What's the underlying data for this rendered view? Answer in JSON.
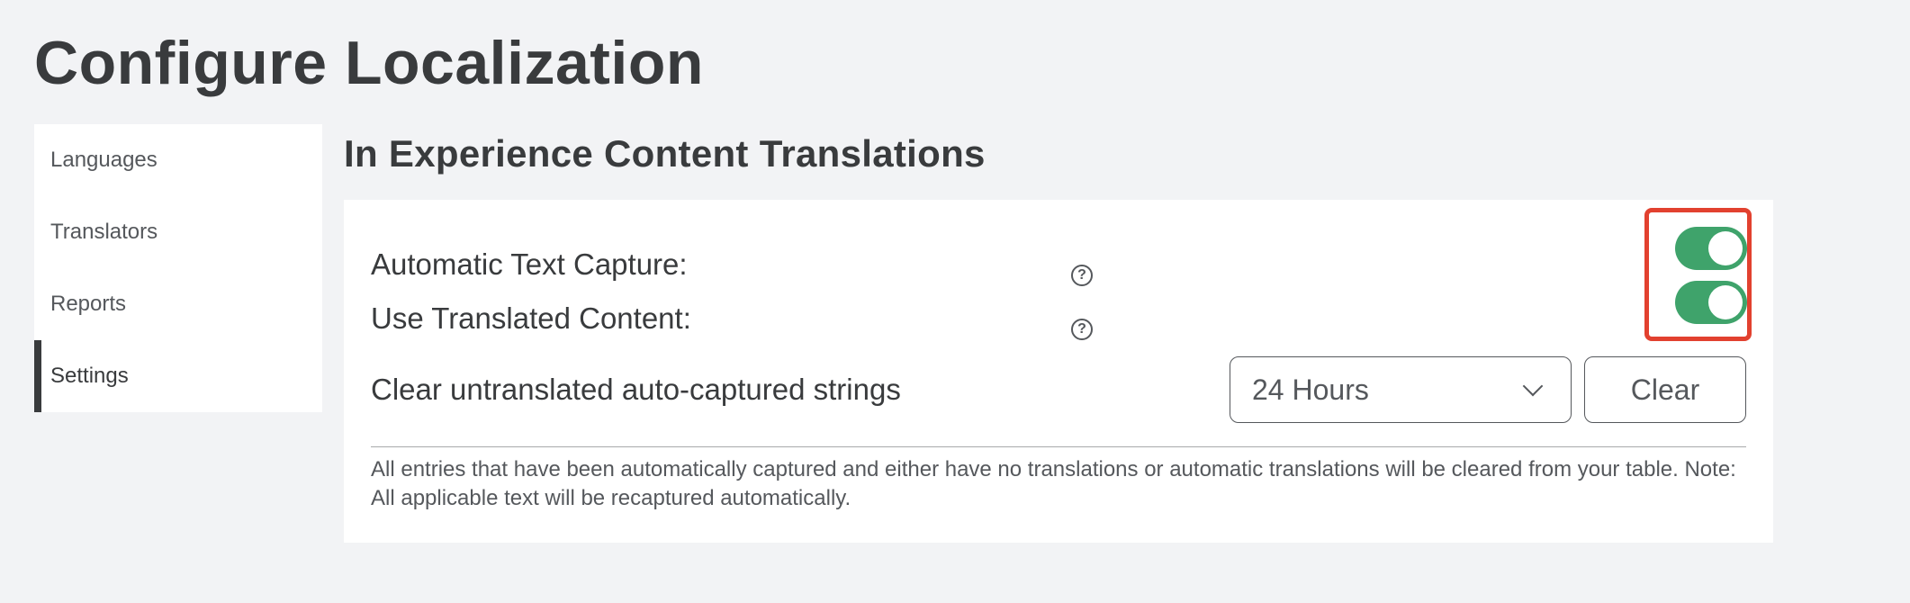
{
  "page": {
    "title": "Configure Localization"
  },
  "sidebar": {
    "items": [
      {
        "label": "Languages",
        "active": false
      },
      {
        "label": "Translators",
        "active": false
      },
      {
        "label": "Reports",
        "active": false
      },
      {
        "label": "Settings",
        "active": true
      }
    ]
  },
  "section": {
    "title": "In Experience Content Translations"
  },
  "settings": {
    "automatic_text_capture": {
      "label": "Automatic Text Capture:",
      "help_icon": "?",
      "enabled": true
    },
    "use_translated_content": {
      "label": "Use Translated Content:",
      "help_icon": "?",
      "enabled": true
    },
    "clear_strings": {
      "label": "Clear untranslated auto-captured strings",
      "selected_option": "24 Hours",
      "button_label": "Clear"
    },
    "note": "All entries that have been automatically captured and either have no translations or automatic translations will be cleared from your table. Note: All applicable text will be recaptured automatically."
  },
  "colors": {
    "toggle_on": "#3fa36b",
    "highlight": "#e2412f",
    "background": "#f2f3f5",
    "text": "#393b3d"
  },
  "icons": {
    "help": "help-circle-icon",
    "dropdown": "chevron-down-icon"
  }
}
